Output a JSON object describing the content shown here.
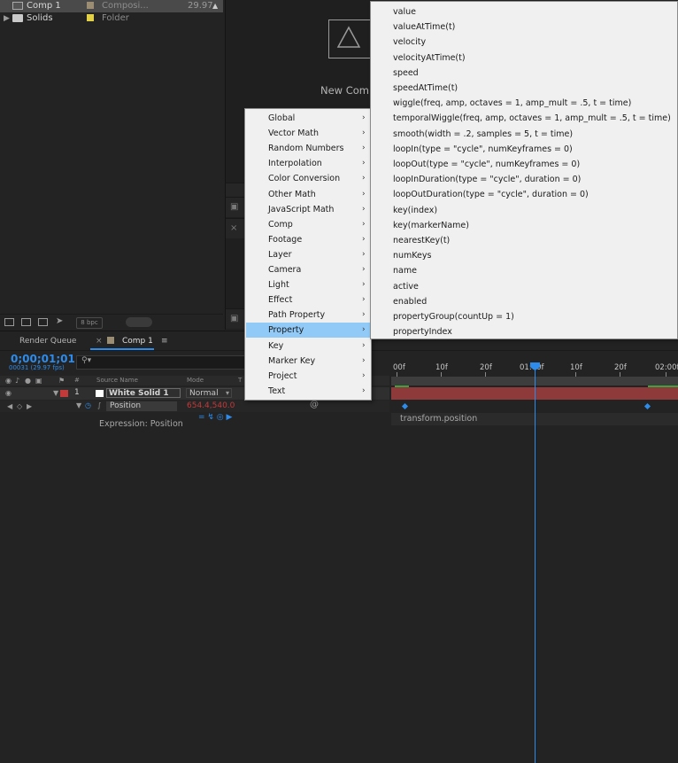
{
  "project": {
    "rows": [
      {
        "name": "Comp 1",
        "type": "Composi...",
        "fps": "29.97",
        "selected": true
      },
      {
        "name": "Solids",
        "type": "Folder",
        "fps": "",
        "selected": false
      }
    ],
    "bpc": "8 bpc"
  },
  "viewer": {
    "new_comp_text": "New Comp"
  },
  "timeline": {
    "tabs": {
      "render_queue": "Render Queue",
      "close": "×",
      "comp": "Comp 1",
      "menu": "≡"
    },
    "timecode": "0;00;01;01",
    "fps_sub": "00031 (29.97 fps)",
    "headers": {
      "hash": "#",
      "source_name": "Source Name",
      "mode": "Mode",
      "t": "T"
    },
    "layer": {
      "number": "1",
      "name": "White Solid 1",
      "mode": "Normal"
    },
    "property": {
      "name": "Position",
      "value": "654.4,540.0"
    },
    "expression_label": "Expression: Position",
    "expression_text": "transform.position",
    "ruler": [
      "00f",
      "10f",
      "20f",
      "01:00f",
      "10f",
      "20f",
      "02:00f"
    ]
  },
  "menu_categories": [
    "Global",
    "Vector Math",
    "Random Numbers",
    "Interpolation",
    "Color Conversion",
    "Other Math",
    "JavaScript Math",
    "Comp",
    "Footage",
    "Layer",
    "Camera",
    "Light",
    "Effect",
    "Path Property",
    "Property",
    "Key",
    "Marker Key",
    "Project",
    "Text"
  ],
  "menu_highlighted": "Property",
  "property_items": [
    "value",
    "valueAtTime(t)",
    "velocity",
    "velocityAtTime(t)",
    "speed",
    "speedAtTime(t)",
    "wiggle(freq, amp, octaves = 1, amp_mult = .5, t = time)",
    "temporalWiggle(freq, amp, octaves = 1, amp_mult = .5, t = time)",
    "smooth(width = .2, samples = 5, t = time)",
    "loopIn(type = \"cycle\", numKeyframes = 0)",
    "loopOut(type = \"cycle\", numKeyframes = 0)",
    "loopInDuration(type = \"cycle\", duration = 0)",
    "loopOutDuration(type = \"cycle\", duration = 0)",
    "key(index)",
    "key(markerName)",
    "nearestKey(t)",
    "numKeys",
    "name",
    "active",
    "enabled",
    "propertyGroup(countUp = 1)",
    "propertyIndex"
  ],
  "colors": {
    "accent": "#2d8ceb",
    "highlight": "#91c9f7",
    "layer_bar": "#8f3a3a",
    "label_red": "#c23a3a"
  }
}
